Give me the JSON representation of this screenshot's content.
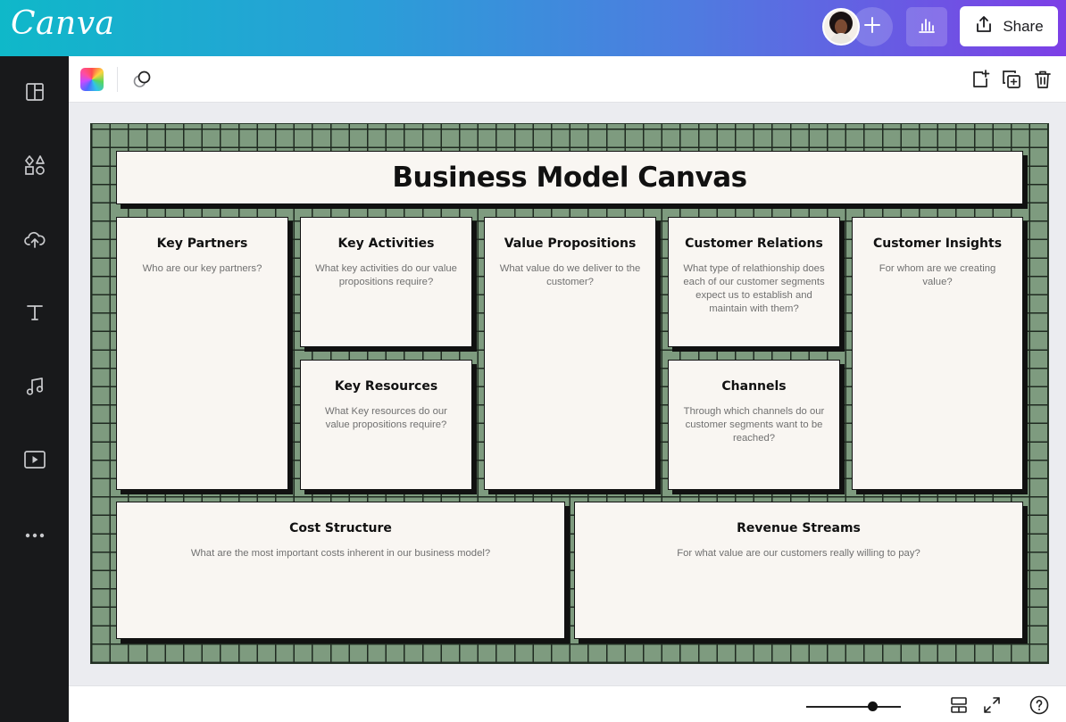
{
  "header": {
    "logo": "Canva",
    "share_label": "Share",
    "icons": {
      "add": "plus-icon",
      "insights": "bar-chart-icon",
      "share": "share-upload-icon"
    }
  },
  "sidebar": {
    "items": [
      {
        "icon": "layout-icon",
        "name": "design"
      },
      {
        "icon": "elements-icon",
        "name": "elements"
      },
      {
        "icon": "upload-cloud-icon",
        "name": "uploads"
      },
      {
        "icon": "text-icon",
        "name": "text"
      },
      {
        "icon": "music-icon",
        "name": "audio"
      },
      {
        "icon": "video-play-icon",
        "name": "videos"
      },
      {
        "icon": "more-icon",
        "name": "more"
      }
    ]
  },
  "toolbar": {
    "icons": [
      "color-picker-icon",
      "transparency-icon",
      "add-page-icon",
      "duplicate-page-icon",
      "trash-icon"
    ]
  },
  "canvas": {
    "title": "Business Model Canvas",
    "cells": {
      "key_partners": {
        "heading": "Key Partners",
        "prompt": "Who are our key partners?"
      },
      "key_activities": {
        "heading": "Key Activities",
        "prompt": "What key activities do our value propositions require?"
      },
      "key_resources": {
        "heading": "Key Resources",
        "prompt": "What Key resources do our value propositions require?"
      },
      "value_propositions": {
        "heading": "Value Propositions",
        "prompt": "What value do we deliver to the customer?"
      },
      "customer_relations": {
        "heading": "Customer Relations",
        "prompt": "What type of relathionship does each of our customer segments expect us to establish and maintain with them?"
      },
      "channels": {
        "heading": "Channels",
        "prompt": "Through which channels do our customer segments want to be reached?"
      },
      "customer_insights": {
        "heading": "Customer Insights",
        "prompt": "For whom are we creating value?"
      },
      "cost_structure": {
        "heading": "Cost Structure",
        "prompt": "What are the most important costs inherent in our business model?"
      },
      "revenue_streams": {
        "heading": "Revenue Streams",
        "prompt": "For what value are our customers really willing to pay?"
      }
    }
  },
  "footer": {
    "zoom_level": 0.7,
    "icons": [
      "grid-view-icon",
      "fullscreen-icon",
      "help-icon"
    ]
  },
  "colors": {
    "header_gradient_start": "#0fb8c9",
    "header_gradient_end": "#7d3fe6",
    "sidebar_bg": "#18191b",
    "board_green": "#7e9b7f",
    "card_bg": "#f9f6f2"
  }
}
